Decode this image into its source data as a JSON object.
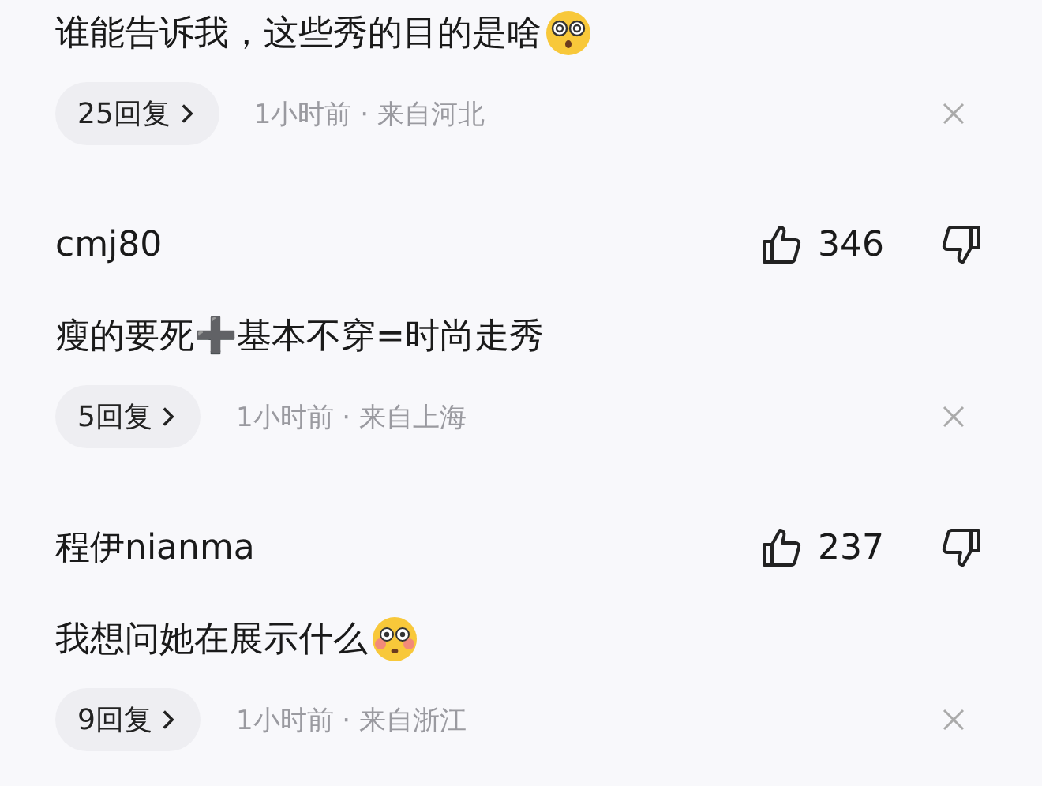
{
  "comments": [
    {
      "text": "谁能告诉我，这些秀的目的是啥",
      "kind": "dizzy",
      "replies": "25回复",
      "meta": "1小时前 · 来自河北"
    },
    {
      "kind": "plain",
      "username": "cmj80",
      "likes": "346",
      "text": "瘦的要死➕基本不穿=时尚走秀",
      "replies": "5回复",
      "meta": "1小时前 · 来自上海"
    },
    {
      "username": "程伊nianma",
      "likes": "237",
      "text": "我想问她在展示什么",
      "kind": "flushed",
      "replies": "9回复",
      "meta": "1小时前 · 来自浙江"
    }
  ]
}
